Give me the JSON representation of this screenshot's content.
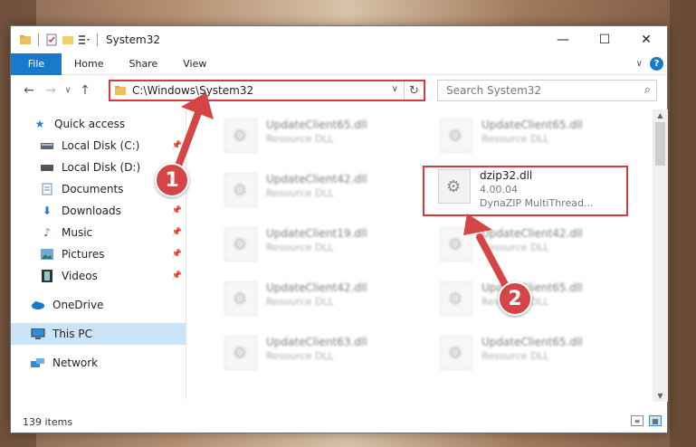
{
  "window": {
    "title": "System32"
  },
  "window_controls": {
    "minimize": "—",
    "maximize": "☐",
    "close": "✕"
  },
  "ribbon": {
    "tabs": [
      "File",
      "Home",
      "Share",
      "View"
    ],
    "expand": "∨",
    "help": "?"
  },
  "navigation": {
    "back": "←",
    "forward": "→",
    "dropdown": "∨",
    "up": "↑"
  },
  "address_bar": {
    "path": "C:\\Windows\\System32",
    "dropdown": "∨",
    "refresh": "↻"
  },
  "search": {
    "placeholder": "Search System32",
    "icon": "⌕"
  },
  "sidebar": {
    "items": [
      {
        "label": "Quick access",
        "icon": "star-icon"
      },
      {
        "label": "Local Disk (C:)",
        "icon": "drive-icon"
      },
      {
        "label": "Local Disk (D:)",
        "icon": "drive-icon"
      },
      {
        "label": "Documents",
        "icon": "document-icon"
      },
      {
        "label": "Downloads",
        "icon": "download-icon"
      },
      {
        "label": "Music",
        "icon": "music-icon"
      },
      {
        "label": "Pictures",
        "icon": "pictures-icon"
      },
      {
        "label": "Videos",
        "icon": "video-icon"
      },
      {
        "label": "OneDrive",
        "icon": "cloud-icon"
      },
      {
        "label": "This PC",
        "icon": "computer-icon"
      },
      {
        "label": "Network",
        "icon": "network-icon"
      }
    ],
    "selected": "This PC"
  },
  "files": {
    "left": [
      {
        "name": "UpdateClient65.dll",
        "type": "Resource DLL"
      },
      {
        "name": "UpdateClient42.dll",
        "type": "Resource DLL"
      },
      {
        "name": "UpdateClient19.dll",
        "type": "Resource DLL"
      },
      {
        "name": "UpdateClient42.dll",
        "type": "Resource DLL"
      },
      {
        "name": "UpdateClient63.dll",
        "type": "Resource DLL"
      }
    ],
    "right": [
      {
        "name": "UpdateClient65.dll",
        "type": "Resource DLL"
      },
      {
        "name": "dzip32.dll",
        "version": "4.00.04",
        "type": "DynaZIP MultiThread..."
      },
      {
        "name": "UpdateClient42.dll",
        "type": "Resource DLL"
      },
      {
        "name": "UpdateClient65.dll",
        "type": "Resource DLL"
      },
      {
        "name": "UpdateClient65.dll",
        "type": "Resource DLL"
      }
    ]
  },
  "status": {
    "items_count": "139 items"
  },
  "callouts": {
    "first": "1",
    "second": "2"
  },
  "colors": {
    "accent": "#1979ca",
    "highlight_red": "#d63a3a",
    "selected_bg": "#cce4f7"
  }
}
